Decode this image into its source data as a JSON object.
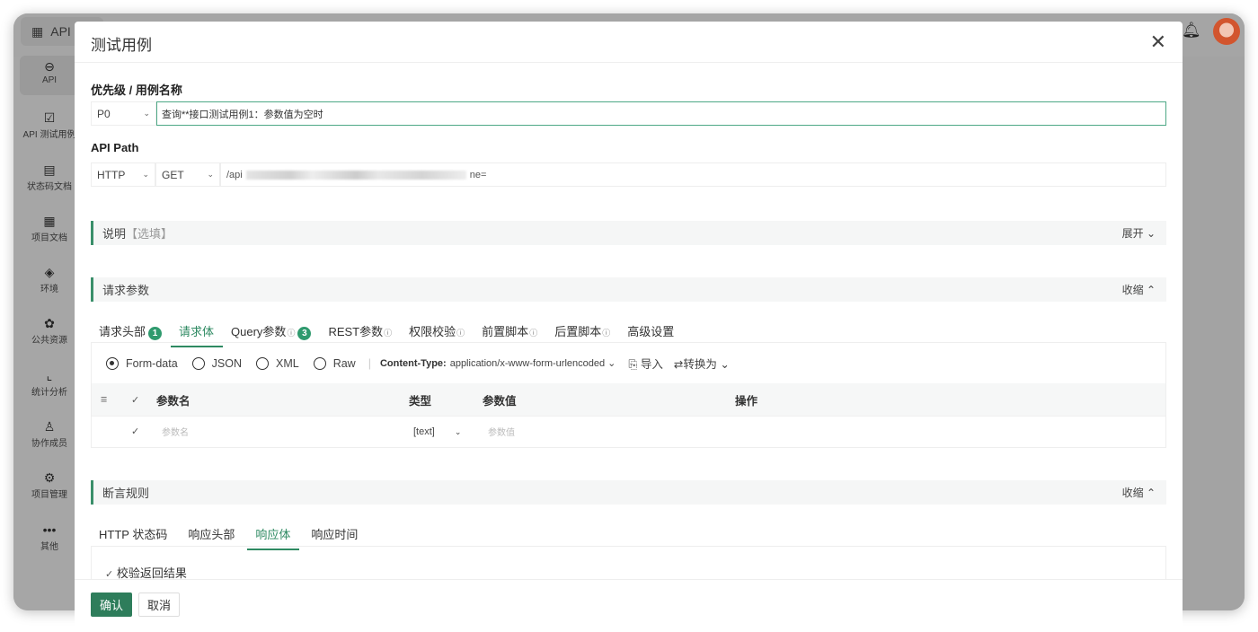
{
  "app": {
    "name": "API",
    "notification_icon": "bell-icon",
    "avatar_icon": "avatar"
  },
  "sidebar": {
    "items": [
      {
        "label": "API",
        "icon": "link-icon",
        "glyph": "⊖"
      },
      {
        "label": "API 测试用例",
        "icon": "clipboard-check-icon",
        "glyph": "☑"
      },
      {
        "label": "状态码文档",
        "icon": "doc-icon",
        "glyph": "▤"
      },
      {
        "label": "项目文档",
        "icon": "book-icon",
        "glyph": "▦"
      },
      {
        "label": "环境",
        "icon": "environment-icon",
        "glyph": "◈"
      },
      {
        "label": "公共资源",
        "icon": "puzzle-icon",
        "glyph": "✿"
      },
      {
        "label": "统计分析",
        "icon": "chart-icon",
        "glyph": "⌞"
      },
      {
        "label": "协作成员",
        "icon": "user-icon",
        "glyph": "♙"
      },
      {
        "label": "项目管理",
        "icon": "gear-icon",
        "glyph": "⚙"
      },
      {
        "label": "其他",
        "icon": "more-icon",
        "glyph": "•••"
      }
    ]
  },
  "modal": {
    "title": "测试用例",
    "priority_label": "优先级 / 用例名称",
    "priority": "P0",
    "case_name": "查询**接口测试用例1：参数值为空时",
    "api_path_label": "API Path",
    "protocol": "HTTP",
    "method": "GET",
    "path_prefix": "/api",
    "path_suffix": "ne=",
    "description": {
      "label": "说明",
      "optional": "【选填】",
      "toggle": "展开 ⌄"
    },
    "request": {
      "label": "请求参数",
      "toggle": "收缩 ⌃",
      "tabs": [
        {
          "label": "请求头部",
          "badge": "1"
        },
        {
          "label": "请求体",
          "active": true
        },
        {
          "label": "Query参数",
          "info": "ⓘ",
          "badge": "3"
        },
        {
          "label": "REST参数",
          "info": "ⓘ"
        },
        {
          "label": "权限校验",
          "info": "ⓘ"
        },
        {
          "label": "前置脚本",
          "info": "ⓘ"
        },
        {
          "label": "后置脚本",
          "info": "ⓘ"
        },
        {
          "label": "高级设置"
        }
      ],
      "body_types": [
        "Form-data",
        "JSON",
        "XML",
        "Raw"
      ],
      "selected_body_type": "Form-data",
      "content_type_label": "Content-Type:",
      "content_type": "application/x-www-form-urlencoded",
      "import_label": "导入",
      "convert_label": "转换为",
      "table": {
        "headers": [
          "参数名",
          "类型",
          "参数值",
          "操作"
        ],
        "rows": [
          {
            "name_placeholder": "参数名",
            "type": "[text]",
            "value_placeholder": "参数值"
          }
        ]
      }
    },
    "assertions": {
      "label": "断言规则",
      "toggle": "收缩 ⌃",
      "tabs": [
        "HTTP 状态码",
        "响应头部",
        "响应体",
        "响应时间"
      ],
      "active_tab": "响应体",
      "check_label": "校验返回结果"
    },
    "confirm": "确认",
    "cancel": "取消"
  },
  "colors": {
    "accent": "#2e8a62",
    "confirm": "#2e7d5b",
    "badge": "#2f9a6e"
  }
}
